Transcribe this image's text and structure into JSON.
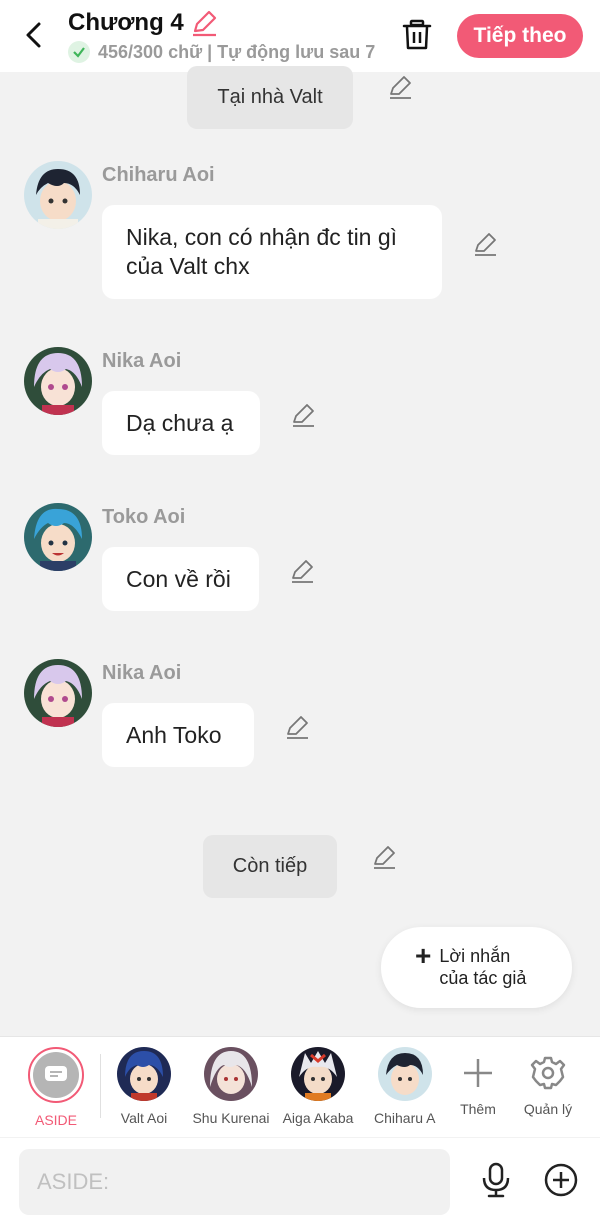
{
  "header": {
    "title": "Chương 4",
    "status": "456/300 chữ | Tự động lưu sau 7",
    "next_label": "Tiếp theo"
  },
  "messages": [
    {
      "type": "narration",
      "text": "Tại nhà Valt"
    },
    {
      "type": "dialogue",
      "name": "Chiharu Aoi",
      "text": "Nika, con có nhận đc tin gì của Valt chx"
    },
    {
      "type": "dialogue",
      "name": "Nika Aoi",
      "text": "Dạ chưa ạ"
    },
    {
      "type": "dialogue",
      "name": "Toko Aoi",
      "text": "Con về rồi"
    },
    {
      "type": "dialogue",
      "name": "Nika Aoi",
      "text": "Anh Toko"
    },
    {
      "type": "narration",
      "text": "Còn tiếp"
    }
  ],
  "fab": {
    "label": "Lời nhắn của tác giả"
  },
  "characters": [
    {
      "name": "ASIDE"
    },
    {
      "name": "Valt Aoi"
    },
    {
      "name": "Shu Kurenai"
    },
    {
      "name": "Aiga Akaba"
    },
    {
      "name": "Chiharu Aoi"
    },
    {
      "name": "Thêm"
    },
    {
      "name": "Quản lý"
    }
  ],
  "input": {
    "placeholder": "ASIDE:"
  },
  "colors": {
    "accent": "#f25a76",
    "background": "#f2f2f2",
    "bubble": "#ffffff",
    "muted": "#9a9a9a"
  },
  "icons": [
    "back-arrow-icon",
    "pencil-icon",
    "check-icon",
    "trash-icon",
    "plus-icon",
    "gear-icon",
    "microphone-icon",
    "plus-circle-icon",
    "chat-bubble-icon"
  ]
}
